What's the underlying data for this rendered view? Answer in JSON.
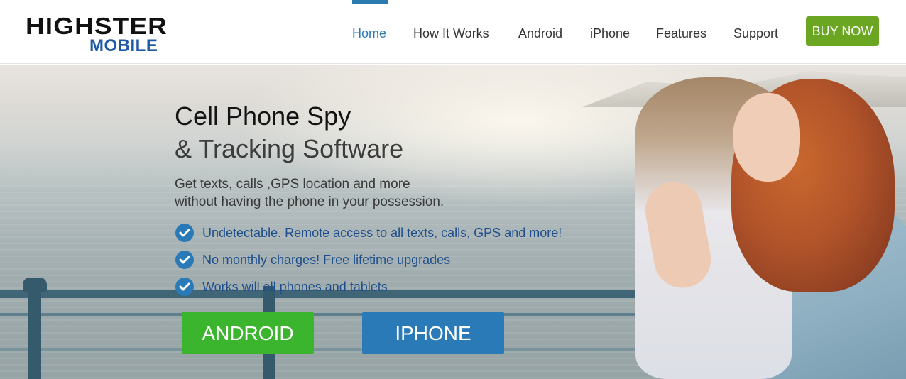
{
  "logo": {
    "line1": "HIGHSTER",
    "line2": "MOBILE"
  },
  "nav": {
    "items": [
      {
        "label": "Home",
        "active": true
      },
      {
        "label": "How It Works",
        "active": false
      },
      {
        "label": "Android",
        "active": false
      },
      {
        "label": "iPhone",
        "active": false
      },
      {
        "label": "Features",
        "active": false
      },
      {
        "label": "Support",
        "active": false
      }
    ],
    "cta_label": "BUY NOW"
  },
  "hero": {
    "title": "Cell Phone Spy",
    "subtitle": "& Tracking Software",
    "description_line1": "Get texts, calls ,GPS location and more",
    "description_line2": "without having the phone in your possession.",
    "features": [
      "Undetectable. Remote access to all texts, calls, GPS and more!",
      "No monthly charges! Free lifetime upgrades",
      "Works will all phones and tablets"
    ],
    "android_button": "ANDROID",
    "iphone_button": "IPHONE"
  },
  "colors": {
    "accent_blue": "#2a7ab0",
    "buy_green": "#6aa622",
    "android_green": "#3cb52e",
    "iphone_blue": "#2a7ab8",
    "logo_blue": "#1f5aa6"
  },
  "icons": {
    "feature_bullet": "check-circle-icon"
  }
}
